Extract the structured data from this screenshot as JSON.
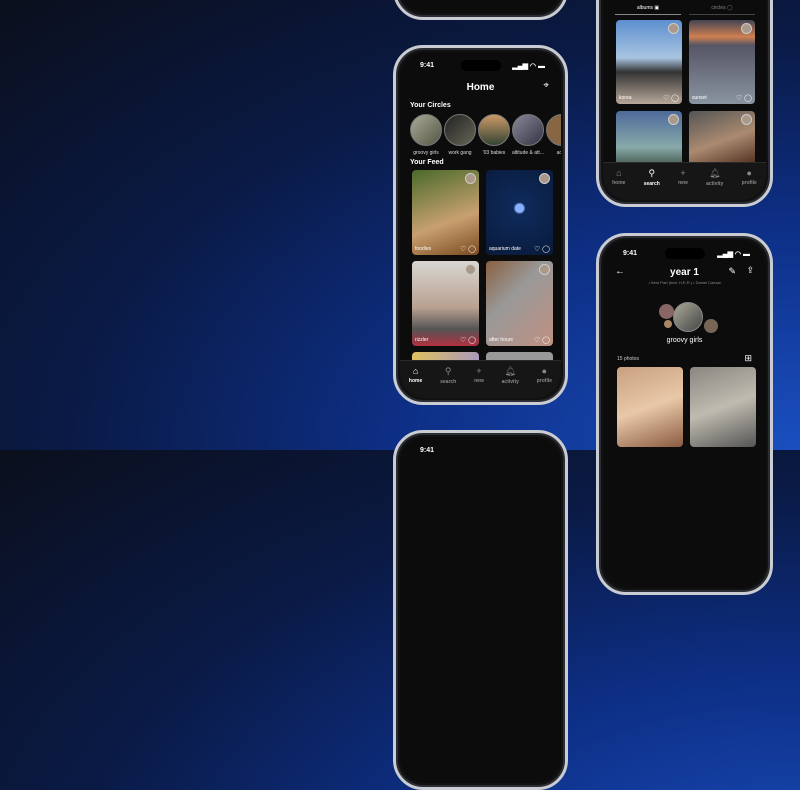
{
  "status_time": "9:41",
  "home": {
    "title": "Home",
    "circles_heading": "Your Circles",
    "feed_heading": "Your Feed",
    "circles": [
      "groovy girls",
      "work gang",
      "'03 babies",
      "altitude & att...",
      "adve"
    ],
    "feed": [
      {
        "label": "foodies"
      },
      {
        "label": "aquarium date"
      },
      {
        "label": "rizzler"
      },
      {
        "label": "after hours"
      }
    ]
  },
  "nav": {
    "items": [
      {
        "label": "home",
        "icon": "home-icon"
      },
      {
        "label": "search",
        "icon": "search-icon"
      },
      {
        "label": "new",
        "icon": "plus-icon"
      },
      {
        "label": "activity",
        "icon": "bell-icon"
      },
      {
        "label": "profile",
        "icon": "person-icon"
      }
    ]
  },
  "search": {
    "tabs": [
      "albums",
      "circles"
    ],
    "cards": [
      {
        "label": "korea"
      },
      {
        "label": "sunset"
      }
    ]
  },
  "album": {
    "title": "year 1",
    "song": "Best Part (feat. H.E.R.) • Daniel Caesar",
    "circle": "groovy girls",
    "photo_count": "15 photos"
  }
}
